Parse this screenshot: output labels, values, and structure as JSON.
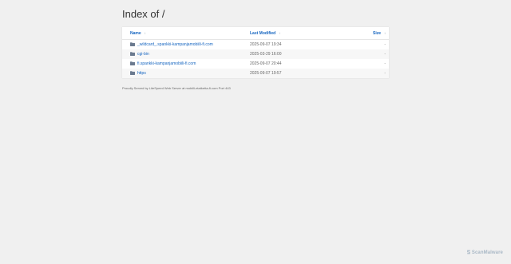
{
  "page": {
    "title": "Index of /"
  },
  "columns": {
    "name": "Name",
    "modified": "Last Modified",
    "size": "Size",
    "sort_arrow": "↕"
  },
  "entries": [
    {
      "icon": "folder-icon",
      "name": "_wildcard_.spankki-kampanjamobiili-fi.com",
      "modified": "2025-09-07 19:34",
      "size": "-"
    },
    {
      "icon": "folder-icon",
      "name": "cgi-bin",
      "modified": "2025-03-29 16:00",
      "size": "-"
    },
    {
      "icon": "folder-icon",
      "name": "fi.spankki-kampanjamobiili-fi.com",
      "modified": "2025-09-07 20:44",
      "size": "-"
    },
    {
      "icon": "folder-icon",
      "name": "https",
      "modified": "2025-09-07 19:57",
      "size": "-"
    }
  ],
  "footer": {
    "text": "Proudly Served by LiteSpeed Web Server at mobiili-etatketta-fi.com Port 443"
  },
  "watermark": {
    "text": "ScanMalware"
  },
  "colors": {
    "link": "#1565c0",
    "background": "#f0f0f0",
    "panel": "#ffffff",
    "folder": "#6b7a8f"
  }
}
